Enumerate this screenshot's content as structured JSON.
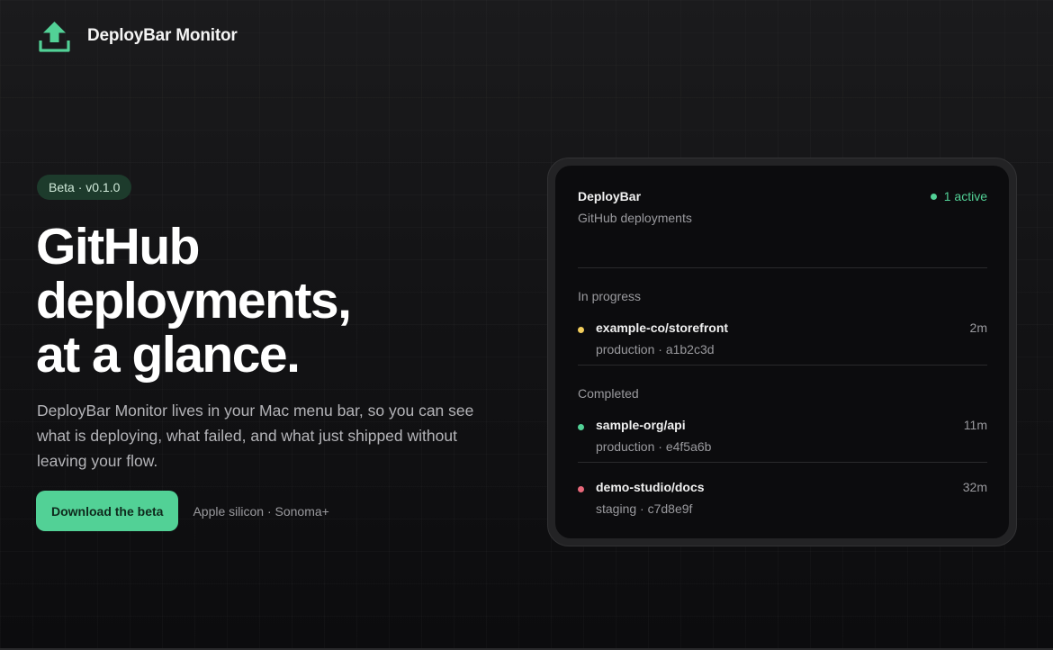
{
  "header": {
    "brand_name": "DeployBar Monitor",
    "icon": "upload-icon",
    "icon_color": "#52d196"
  },
  "hero": {
    "badge": "Beta · v0.1.0",
    "headline": [
      "GitHub",
      "deployments,",
      "at a glance."
    ],
    "subtext": "DeployBar Monitor lives in your Mac menu bar, so you can see what is deploying, what failed, and what just shipped without leaving your flow.",
    "cta_label": "Download the beta",
    "cta_note": "Apple silicon · Sonoma+"
  },
  "preview": {
    "title": "DeployBar",
    "subtitle": "GitHub deployments",
    "active_label": "1 active",
    "sections": [
      {
        "label": "In progress",
        "items": [
          {
            "repo": "example-co/storefront",
            "meta": "production · a1b2c3d",
            "time": "2m",
            "status": "in-progress",
            "color": "#f2cd5c"
          }
        ]
      },
      {
        "label": "Completed",
        "items": [
          {
            "repo": "sample-org/api",
            "meta": "production · e4f5a6b",
            "time": "11m",
            "status": "success",
            "color": "#52d196"
          },
          {
            "repo": "demo-studio/docs",
            "meta": "staging · c7d8e9f",
            "time": "32m",
            "status": "failed",
            "color": "#e8687a"
          }
        ]
      }
    ]
  },
  "colors": {
    "accent": "#52d196",
    "background": "#111113",
    "in_progress": "#f2cd5c",
    "failed": "#e8687a"
  }
}
